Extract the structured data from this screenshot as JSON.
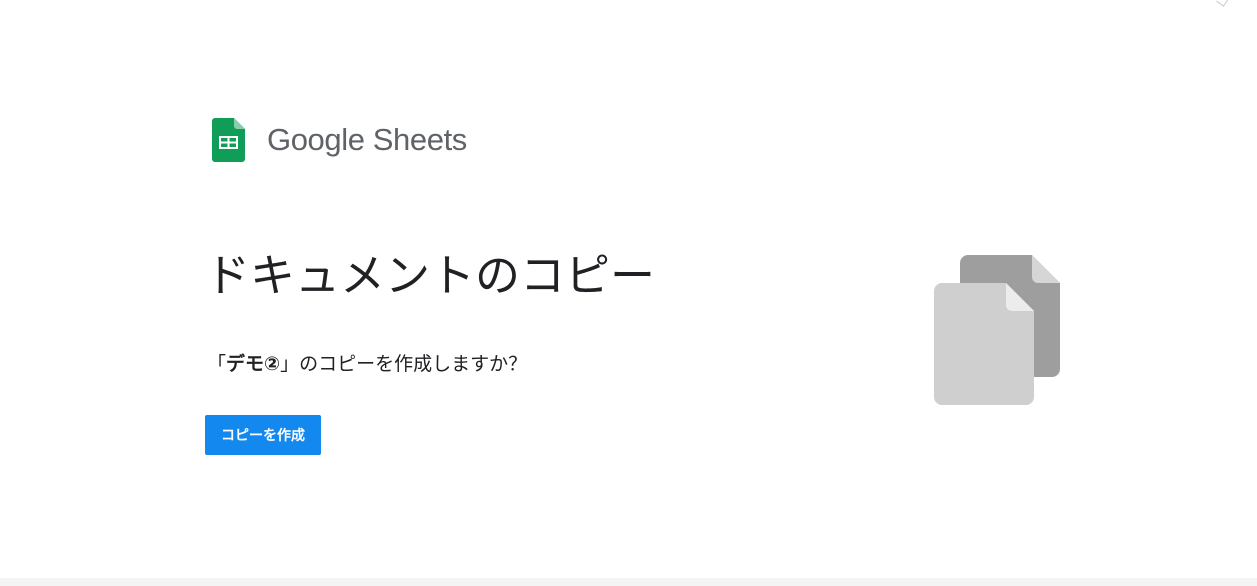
{
  "brand": {
    "name": "Google Sheets",
    "icon": "sheets-icon",
    "icon_color": "#0f9d58"
  },
  "dialog": {
    "title": "ドキュメントのコピー",
    "question_open": "「",
    "document_name": "デモ②",
    "question_rest": "」のコピーを作成しますか？",
    "button_label": "コピーを作成",
    "button_color": "#1388ee",
    "illustration_icon": "copy-documents-icon"
  }
}
